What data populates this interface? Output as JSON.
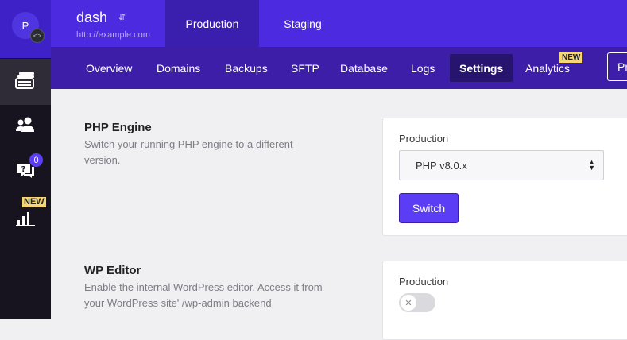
{
  "rail": {
    "avatar_letter": "P",
    "avatar_switch_icon": "code-arrows-icon",
    "items": [
      {
        "name": "sites",
        "icon": "sites-stack-icon"
      },
      {
        "name": "users",
        "icon": "users-icon"
      },
      {
        "name": "help",
        "icon": "help-chat-icon",
        "badge": "0"
      },
      {
        "name": "analytics",
        "icon": "bar-chart-icon",
        "badge": "NEW"
      }
    ]
  },
  "header": {
    "site_name": "dash",
    "site_url": "http://example.com",
    "environments": [
      "Production",
      "Staging"
    ],
    "active_environment": "Production"
  },
  "subnav": {
    "items": [
      "Overview",
      "Domains",
      "Backups",
      "SFTP",
      "Database",
      "Logs",
      "Settings",
      "Analytics"
    ],
    "active": "Settings",
    "new_tag": "NEW",
    "more_label": "Pr"
  },
  "php_engine": {
    "title": "PHP Engine",
    "description": "Switch your running PHP engine to a different version.",
    "env_label": "Production",
    "selected_version": "PHP v8.0.x",
    "switch_button": "Switch"
  },
  "wp_editor": {
    "title": "WP Editor",
    "description": "Enable the internal WordPress editor. Access it from your WordPress site' /wp-admin backend",
    "env_label": "Production",
    "enabled": false
  },
  "colors": {
    "brand": "#4b2ae0",
    "subnav": "#3c1ea8",
    "accent_button": "#5b3df5",
    "new_badge": "#f7d774"
  }
}
